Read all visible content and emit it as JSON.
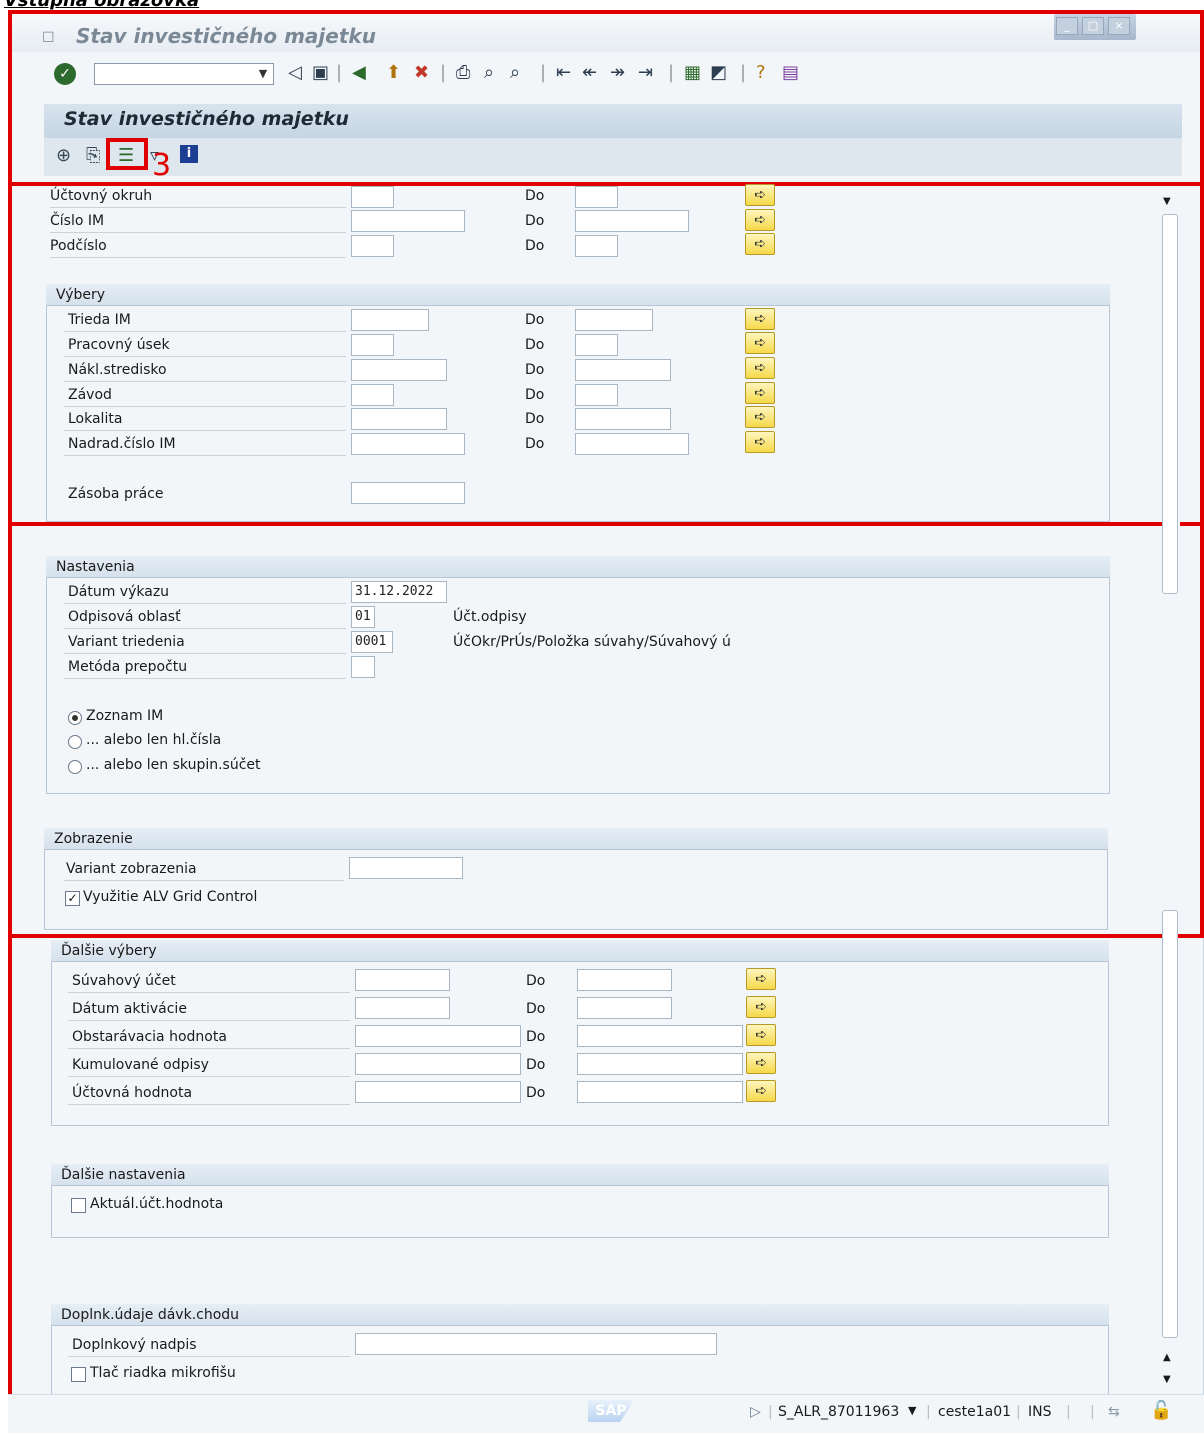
{
  "caption": "Vstupná obrazovka",
  "window": {
    "title": "Stav investičného majetku",
    "controls": [
      "_",
      "□",
      "×"
    ]
  },
  "toolbar": {
    "command_value": "",
    "icons": [
      "enter-icon",
      "back-icon",
      "save-icon",
      "back-green-icon",
      "exit-icon",
      "cancel-icon",
      "print-icon",
      "find-icon",
      "find-next-icon",
      "first-page-icon",
      "prev-page-icon",
      "next-page-icon",
      "last-page-icon",
      "new-session-icon",
      "shortcut-icon",
      "help-icon",
      "layout-icon"
    ]
  },
  "app": {
    "title": "Stav investičného majetku",
    "tools": [
      "execute-icon",
      "get-variant-icon",
      "layout-variant-icon",
      "save-variant-icon",
      "info-icon"
    ],
    "annotation_number": "3"
  },
  "selection": {
    "rows": [
      {
        "label": "Účtovný okruh",
        "do": "Do"
      },
      {
        "label": "Číslo IM",
        "do": "Do"
      },
      {
        "label": "Podčíslo",
        "do": "Do"
      }
    ]
  },
  "vybery": {
    "title": "Výbery",
    "rows": [
      {
        "label": "Trieda IM",
        "do": "Do"
      },
      {
        "label": "Pracovný úsek",
        "do": "Do"
      },
      {
        "label": "Nákl.stredisko",
        "do": "Do"
      },
      {
        "label": "Závod",
        "do": "Do"
      },
      {
        "label": "Lokalita",
        "do": "Do"
      },
      {
        "label": "Nadrad.číslo IM",
        "do": "Do"
      }
    ],
    "zasoba_label": "Zásoba práce"
  },
  "nastavenia": {
    "title": "Nastavenia",
    "datum_label": "Dátum výkazu",
    "datum_value": "31.12.2022",
    "oblast_label": "Odpisová oblasť",
    "oblast_value": "01",
    "oblast_desc": "Účt.odpisy",
    "variant_label": "Variant triedenia",
    "variant_value": "0001",
    "variant_desc": "ÚčOkr/PrÚs/Položka súvahy/Súvahový ú",
    "metoda_label": "Metóda prepočtu",
    "radios": [
      {
        "label": "Zoznam IM",
        "checked": true
      },
      {
        "label": "... alebo len hl.čísla",
        "checked": false
      },
      {
        "label": "... alebo len skupin.súčet",
        "checked": false
      }
    ]
  },
  "zobrazenie": {
    "title": "Zobrazenie",
    "variant_label": "Variant zobrazenia",
    "alv_label": "Využitie ALV Grid Control",
    "alv_checked": true
  },
  "dalsie_vybery": {
    "title": "Ďalšie výbery",
    "rows": [
      {
        "label": "Súvahový účet",
        "do": "Do"
      },
      {
        "label": "Dátum aktivácie",
        "do": "Do"
      },
      {
        "label": "Obstarávacia hodnota",
        "do": "Do"
      },
      {
        "label": "Kumulované odpisy",
        "do": "Do"
      },
      {
        "label": "Účtovná hodnota",
        "do": "Do"
      }
    ]
  },
  "dalsie_nastavenia": {
    "title": "Ďalšie nastavenia",
    "aktual_label": "Aktuál.účt.hodnota"
  },
  "doplnk": {
    "title": "Doplnk.údaje dávk.chodu",
    "nadpis_label": "Doplnkový nadpis",
    "tlac_label": "Tlač riadka mikrofišu"
  },
  "status": {
    "logo": "SAP",
    "transaction": "S_ALR_87011963",
    "user": "ceste1a01",
    "mode": "INS"
  }
}
